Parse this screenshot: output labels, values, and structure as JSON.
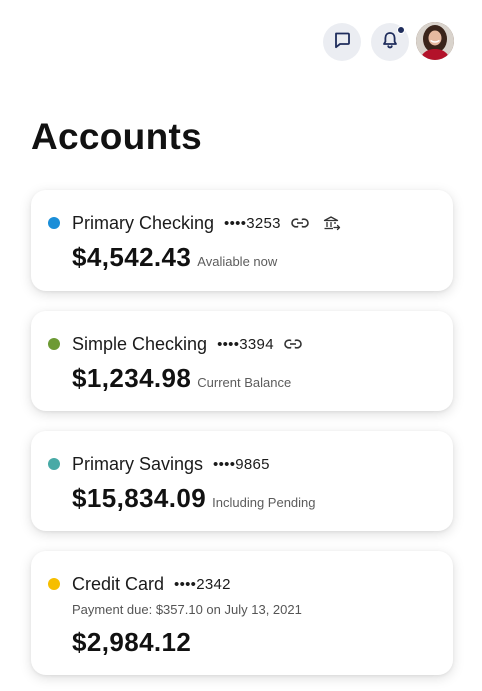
{
  "header": {
    "logo_text": "",
    "icons": [
      "message-icon",
      "bell-icon",
      "avatar"
    ],
    "notification_dot_color": "#1f2d5c"
  },
  "page": {
    "title": "Accounts"
  },
  "accounts": [
    {
      "name": "Primary Checking",
      "mask": "••••3253",
      "amount": "$4,542.43",
      "note": "Avaliable now",
      "color": "#1b8ed8",
      "icons": [
        "link-icon",
        "bank-transfer-icon"
      ]
    },
    {
      "name": "Simple Checking",
      "mask": "••••3394",
      "amount": "$1,234.98",
      "note": "Current Balance",
      "color": "#6d9a34",
      "icons": [
        "link-icon"
      ]
    },
    {
      "name": "Primary Savings",
      "mask": "••••9865",
      "amount": "$15,834.09",
      "note": "Including Pending",
      "color": "#48aaa6",
      "icons": []
    },
    {
      "name": "Credit Card",
      "mask": "••••2342",
      "payment_due": "Payment due: $357.10 on July 13, 2021",
      "amount": "$2,984.12",
      "note": "",
      "color": "#f6be00",
      "icons": []
    }
  ]
}
